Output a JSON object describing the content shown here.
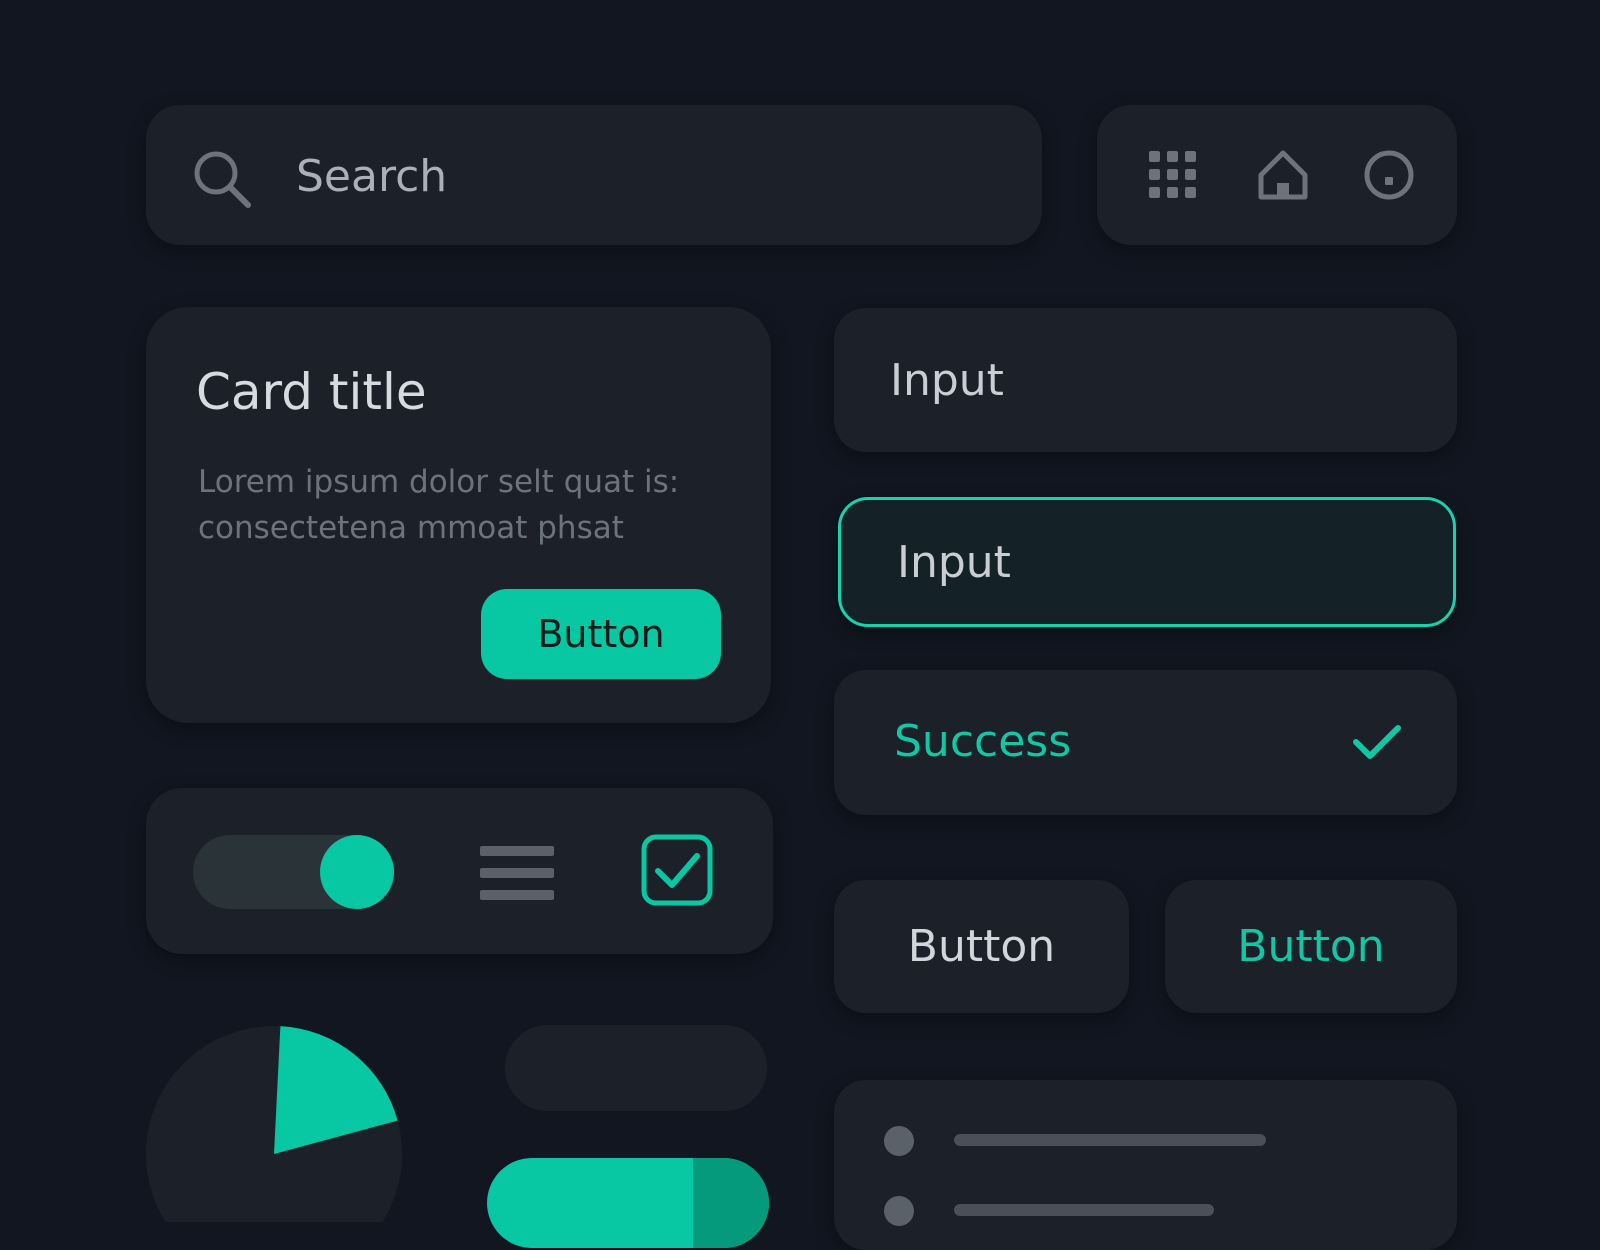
{
  "search": {
    "placeholder": "Search",
    "icon": "search-icon"
  },
  "icon_bar": {
    "icons": [
      "grid-icon",
      "home-icon",
      "circle-icon"
    ]
  },
  "card": {
    "title": "Card title",
    "body": "Lorem ipsum dolor selt quat is: consectetena mmoat phsat",
    "button_label": "Button"
  },
  "controls": {
    "toggle_on": true,
    "menu_icon": "menu-icon",
    "checkbox_checked": true
  },
  "inputs": {
    "default_placeholder": "Input",
    "focused_placeholder": "Input"
  },
  "success": {
    "label": "Success",
    "icon": "check-icon"
  },
  "buttons": {
    "secondary_label": "Button",
    "accent_label": "Button"
  },
  "pie": {
    "accent_fraction": 0.2
  },
  "progress": {
    "value_fraction": 0.73
  },
  "colors": {
    "background": "#111620",
    "panel": "#1b2029",
    "accent": "#07c8a2",
    "accent_dark": "#069a7c",
    "muted_text": "#6b737d"
  }
}
